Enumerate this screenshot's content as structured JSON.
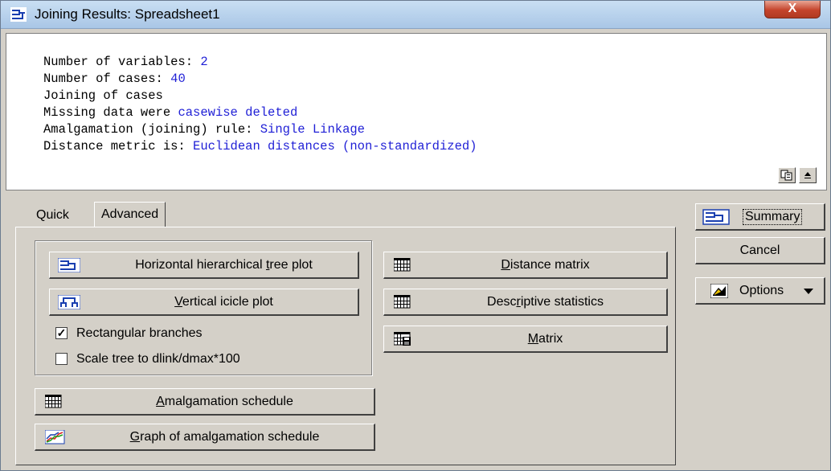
{
  "window": {
    "title": "Joining Results: Spreadsheet1",
    "close_label": "X"
  },
  "output": {
    "lines": [
      {
        "label": "Number of variables: ",
        "value": "2"
      },
      {
        "label": "Number of cases: ",
        "value": "40"
      },
      {
        "label": "Joining of cases",
        "value": ""
      },
      {
        "label": "Missing data were ",
        "value": "casewise deleted"
      },
      {
        "label": "Amalgamation (joining) rule: ",
        "value": "Single Linkage"
      },
      {
        "label": "Distance metric is: ",
        "value": "Euclidean distances (non-standardized)"
      }
    ],
    "value_color": "#1f1fd6"
  },
  "tabs": {
    "quick": "Quick",
    "advanced": "Advanced",
    "active": "Advanced"
  },
  "buttons": {
    "horizontal_tree": {
      "pre": "Horizontal hierarchical ",
      "u": "t",
      "post": "ree plot",
      "icon": "tree-plot-icon"
    },
    "vertical_icicle": {
      "pre": "",
      "u": "V",
      "post": "ertical icicle plot",
      "icon": "icicle-plot-icon"
    },
    "distance_matrix": {
      "pre": "",
      "u": "D",
      "post": "istance matrix",
      "icon": "grid-icon"
    },
    "descriptive_stats": {
      "pre": "Desc",
      "u": "r",
      "post": "iptive statistics",
      "icon": "grid-icon"
    },
    "matrix": {
      "pre": "",
      "u": "M",
      "post": "atrix",
      "icon": "matrix-save-icon"
    },
    "amalgamation_schedule": {
      "pre": "",
      "u": "A",
      "post": "malgamation schedule",
      "icon": "grid-icon"
    },
    "graph_amalgamation": {
      "pre": "",
      "u": "G",
      "post": "raph of amalgamation schedule",
      "icon": "line-graph-icon"
    }
  },
  "checkboxes": {
    "rectangular": {
      "label": "Rectangular branches",
      "checked": true
    },
    "scale_tree": {
      "label": "Scale tree to dlink/dmax*100",
      "checked": false
    }
  },
  "side": {
    "summary": "Summary",
    "cancel": "Cancel",
    "options": "Options"
  }
}
